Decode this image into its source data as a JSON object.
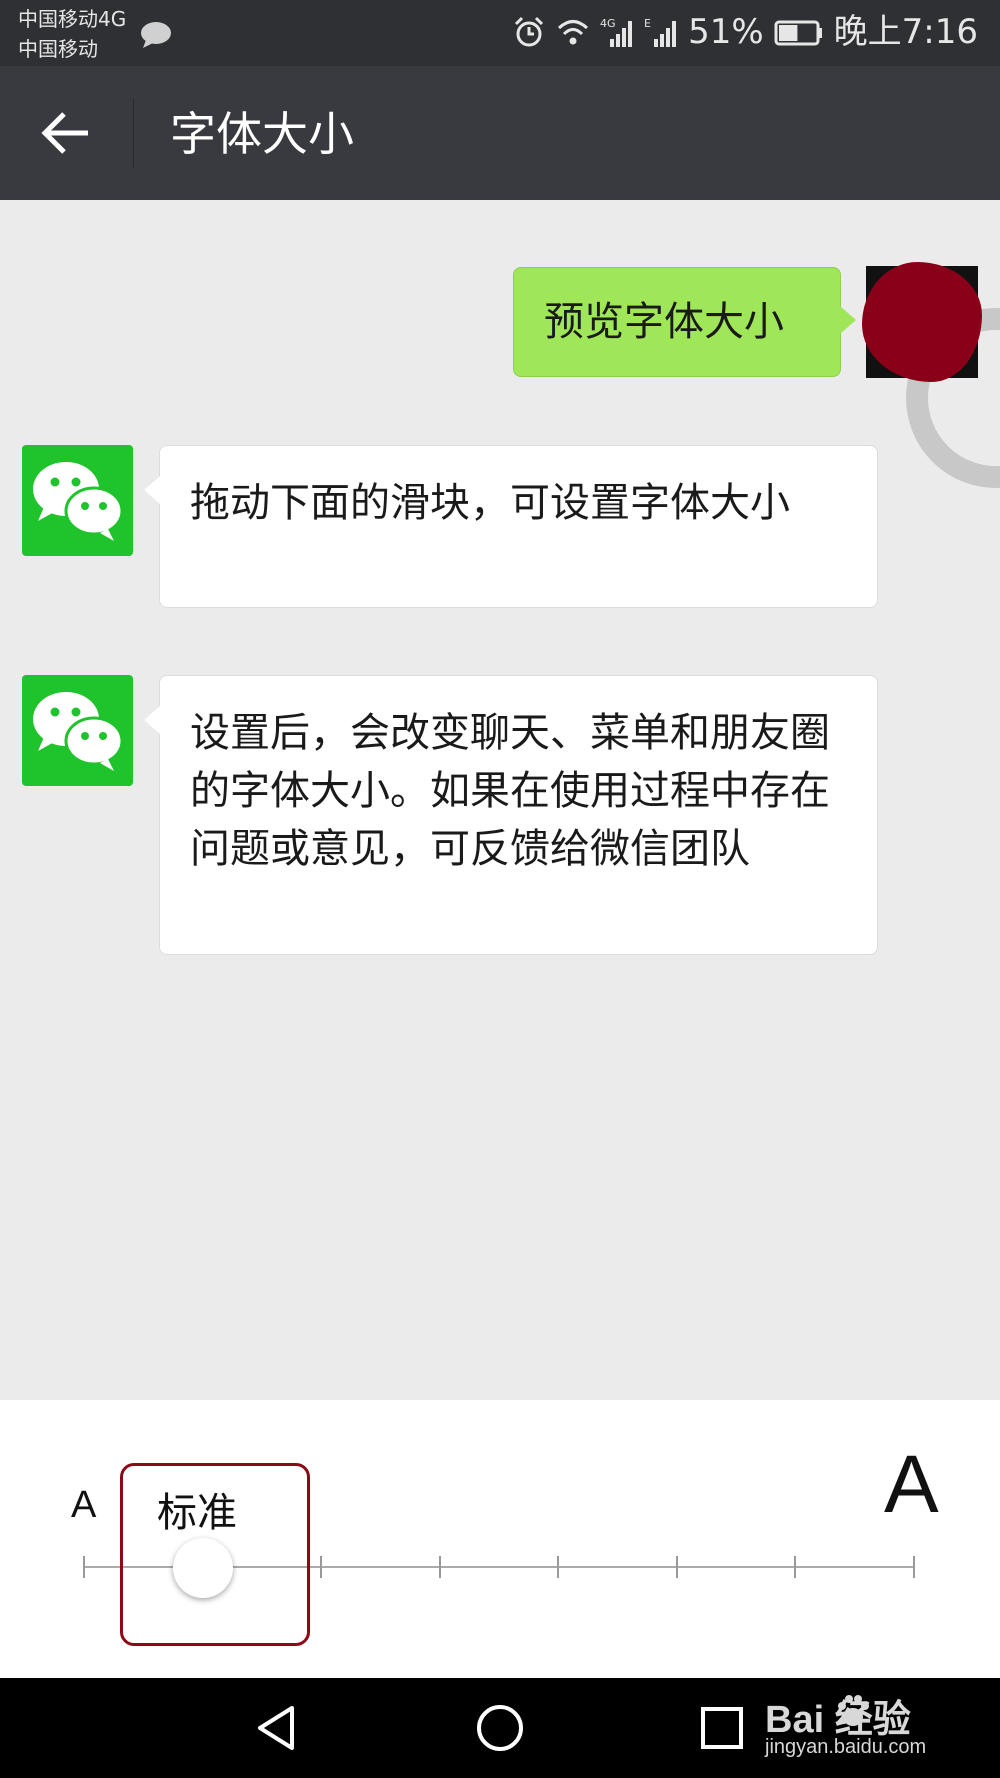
{
  "status_bar": {
    "carrier_primary": "中国移动4G",
    "carrier_secondary": "中国移动",
    "battery_percent": "51%",
    "clock": "晚上7:16",
    "icons": [
      "message-icon",
      "alarm-icon",
      "wifi-icon",
      "signal-4g-icon",
      "signal-e-icon",
      "battery-icon"
    ],
    "battery_level": 0.51
  },
  "header": {
    "title": "字体大小",
    "back_icon": "back-arrow-icon"
  },
  "chat": {
    "messages": [
      {
        "sender": "self",
        "text": "预览字体大小"
      },
      {
        "sender": "wechat",
        "text": "拖动下面的滑块，可设置字体大小"
      },
      {
        "sender": "wechat",
        "text": "设置后，会改变聊天、菜单和朋友圈的字体大小。如果在使用过程中存在问题或意见，可反馈给微信团队"
      }
    ],
    "colors": {
      "outgoing_bubble": "#9fe658",
      "incoming_bubble": "#ffffff",
      "background": "#ebebeb"
    }
  },
  "font_slider": {
    "min_label": "A",
    "max_label": "A",
    "selected_label": "标准",
    "step_count": 8,
    "selected_index": 1
  },
  "nav_bar": {
    "icons": [
      "nav-back-icon",
      "nav-home-icon",
      "nav-recent-icon"
    ]
  },
  "watermark": {
    "logo": "Bai  经验",
    "url": "jingyan.baidu.com"
  }
}
